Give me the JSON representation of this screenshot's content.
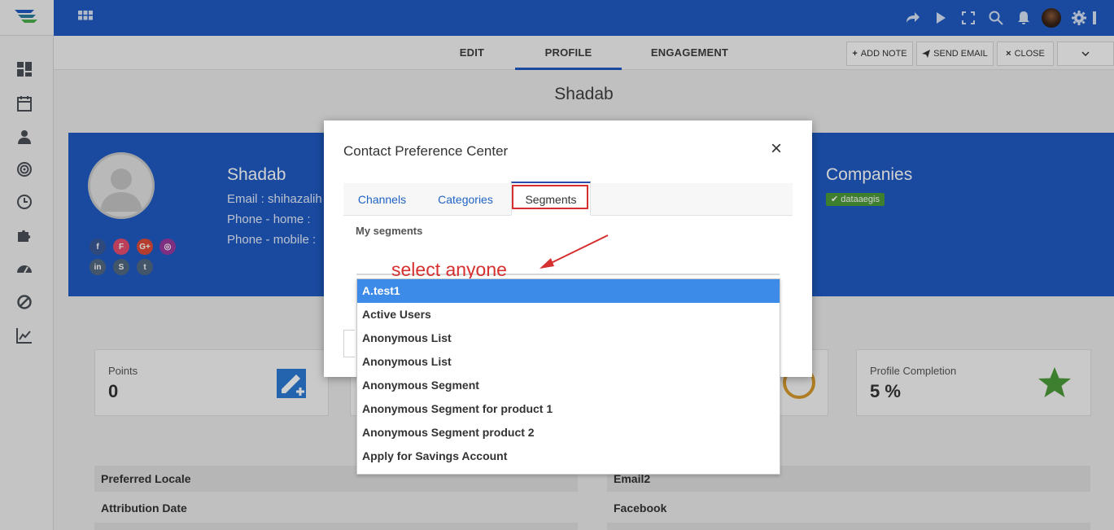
{
  "header": {
    "tabs": [
      {
        "label": "EDIT"
      },
      {
        "label": "PROFILE"
      },
      {
        "label": "ENGAGEMENT"
      }
    ],
    "actions": {
      "add_note": "ADD NOTE",
      "send_email": "SEND EMAIL",
      "close": "CLOSE"
    }
  },
  "contact": {
    "page_title": "Shadab",
    "name": "Shadab",
    "email_line": "Email : shihazalih",
    "phone_home": "Phone - home :",
    "phone_mobile": "Phone - mobile :",
    "companies_title": "Companies",
    "company_badge": "dataaegis"
  },
  "cards": {
    "points_label": "Points",
    "points_value": "0",
    "completion_label": "Profile Completion",
    "completion_value": "5 %"
  },
  "fields": {
    "preferred_locale": "Preferred Locale",
    "attribution_date": "Attribution Date",
    "email2": "Email2",
    "facebook": "Facebook"
  },
  "modal": {
    "title": "Contact Preference Center",
    "close_glyph": "×",
    "tabs": [
      {
        "label": "Channels"
      },
      {
        "label": "Categories"
      },
      {
        "label": "Segments"
      }
    ],
    "section_label": "My segments",
    "segments": [
      "A.test1",
      "Active Users",
      "Anonymous List",
      "Anonymous List",
      "Anonymous Segment",
      "Anonymous Segment for product 1",
      "Anonymous Segment product 2",
      "Apply for Savings Account"
    ],
    "selected_index": 0
  },
  "annotation": {
    "text": "select anyone",
    "color": "#d62f2f"
  },
  "colors": {
    "brand_blue": "#1f5bc4",
    "highlight_blue": "#3d8be8",
    "success_green": "#4c9a3a"
  }
}
